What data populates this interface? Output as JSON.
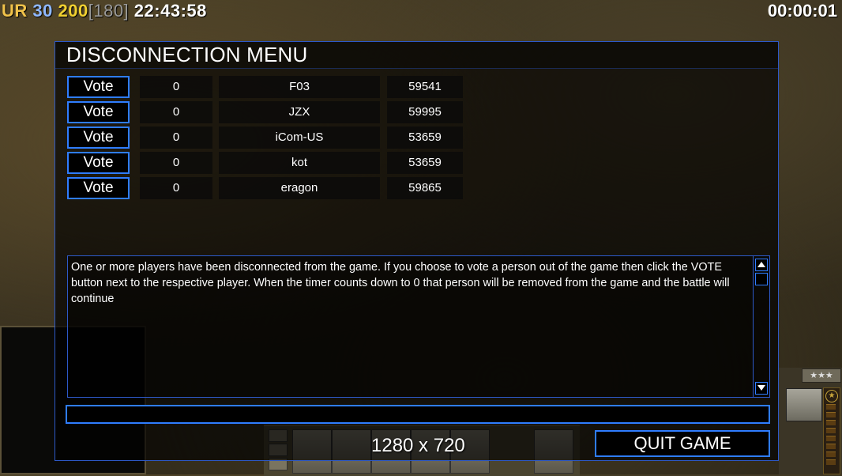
{
  "hud": {
    "ur_label": "UR",
    "val_a": "30",
    "val_b": "200",
    "val_c": "[180]",
    "clock": "22:43:58",
    "timer": "00:00:01"
  },
  "menu": {
    "title": "DISCONNECTION MENU",
    "vote_label": "Vote",
    "players": [
      {
        "count": "0",
        "name": "F03",
        "ping": "59541"
      },
      {
        "count": "0",
        "name": "JZX",
        "ping": "59995"
      },
      {
        "count": "0",
        "name": "iCom-US",
        "ping": "53659"
      },
      {
        "count": "0",
        "name": "kot",
        "ping": "53659"
      },
      {
        "count": "0",
        "name": "eragon",
        "ping": "59865"
      }
    ],
    "message": "One or more players have been disconnected from the game. If you choose to vote a person out of the game then click the VOTE button next to the respective player. When the timer counts down to 0 that person will be removed from the game and the battle will continue",
    "chat_value": "",
    "quit_label": "QUIT GAME"
  },
  "resolution_label": "1280 x 720",
  "side_panel": {
    "rank": "★★★",
    "general_star": "★"
  },
  "colors": {
    "accent": "#2f7dff",
    "frame": "#2d59c8",
    "panel_bg": "#000000"
  }
}
